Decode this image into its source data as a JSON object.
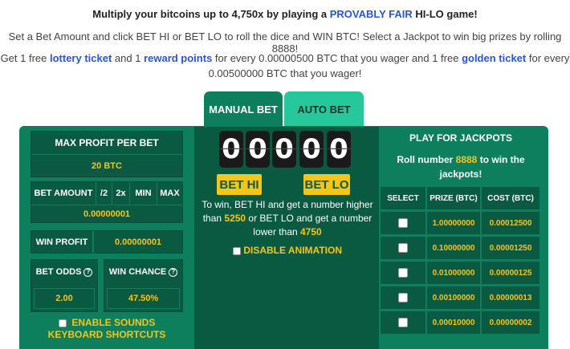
{
  "header": {
    "headline_prefix": "Multiply your bitcoins up to 4,750x by playing a ",
    "headline_highlight": "PROVABLY FAIR",
    "headline_suffix": " HI-LO game!",
    "intro1": "Set a Bet Amount and click BET HI or BET LO to roll the dice and WIN BTC! Select a Jackpot to win big prizes by rolling 8888!",
    "intro2_a": "Get 1 free ",
    "intro2_lottery": "lottery ticket",
    "intro2_b": " and 1 ",
    "intro2_reward": "reward points",
    "intro2_c": " for every 0.00000500 BTC that you wager and 1 free ",
    "intro2_golden": "golden ticket",
    "intro2_d": " for every 0.00500000 BTC that you wager!"
  },
  "tabs": {
    "manual": "MANUAL BET",
    "auto": "AUTO BET"
  },
  "left": {
    "max_profit_label": "MAX PROFIT PER BET",
    "max_profit_value": "20 BTC",
    "bet_amount_label": "BET AMOUNT",
    "btn_half": "/2",
    "btn_double": "2x",
    "btn_min": "MIN",
    "btn_max": "MAX",
    "bet_amount_value": "0.00000001",
    "win_profit_label": "WIN PROFIT",
    "win_profit_value": "0.00000001",
    "bet_odds_label": "BET ODDS",
    "bet_odds_value": "2.00",
    "win_chance_label": "WIN CHANCE",
    "win_chance_value": "47.50%",
    "enable_sounds": "ENABLE SOUNDS",
    "keyboard_shortcuts": "KEYBOARD SHORTCUTS"
  },
  "center": {
    "digits": [
      "0",
      "0",
      "0",
      "0",
      "0"
    ],
    "bet_hi": "BET HI",
    "bet_lo": "BET LO",
    "rules_a": "To win, BET HI and get a number higher than ",
    "hi_number": "5250",
    "rules_b": " or BET LO and get a number lower than ",
    "lo_number": "4750",
    "disable_animation": "DISABLE ANIMATION"
  },
  "jackpots": {
    "title": "PLAY FOR JACKPOTS",
    "sub_a": "Roll number ",
    "sub_number": "8888",
    "sub_b": " to win the jackpots!",
    "columns": [
      "SELECT",
      "PRIZE (BTC)",
      "COST (BTC)"
    ],
    "rows": [
      {
        "prize": "1.00000000",
        "cost": "0.00012500"
      },
      {
        "prize": "0.10000000",
        "cost": "0.00001250"
      },
      {
        "prize": "0.01000000",
        "cost": "0.00000125"
      },
      {
        "prize": "0.00100000",
        "cost": "0.00000013"
      },
      {
        "prize": "0.00010000",
        "cost": "0.00000002"
      }
    ]
  },
  "colors": {
    "panel_green": "#0e7f5d",
    "dark_green": "#0a5a42",
    "auto_tab": "#26c79a",
    "accent_yellow": "#f5c518",
    "link_blue": "#2a55d0"
  }
}
